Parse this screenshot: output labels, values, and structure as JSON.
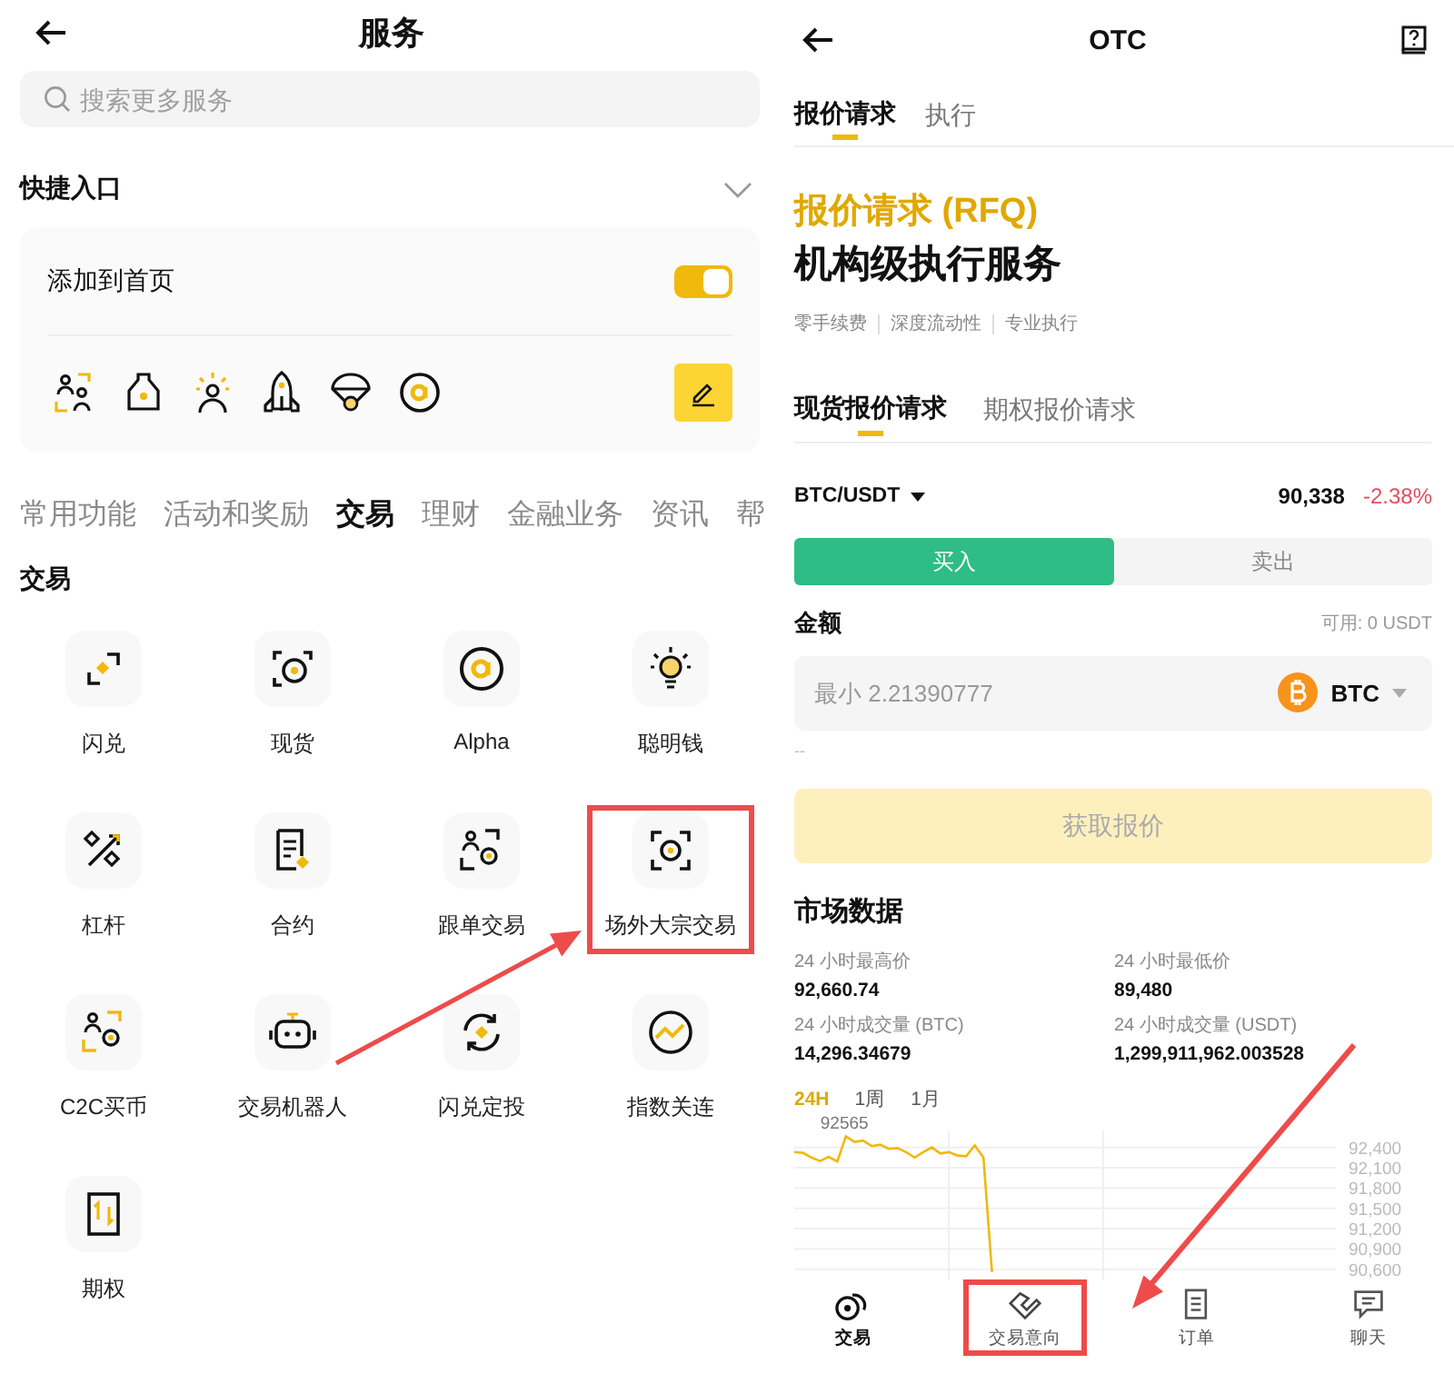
{
  "left": {
    "title": "服务",
    "search": {
      "placeholder": "搜索更多服务"
    },
    "quick_access": {
      "title": "快捷入口",
      "add_to_home": {
        "label": "添加到首页",
        "on": true
      }
    },
    "categories": [
      {
        "label": "常用功能",
        "selected": false
      },
      {
        "label": "活动和奖励",
        "selected": false
      },
      {
        "label": "交易",
        "selected": true
      },
      {
        "label": "理财",
        "selected": false
      },
      {
        "label": "金融业务",
        "selected": false
      },
      {
        "label": "资讯",
        "selected": false
      },
      {
        "label": "帮",
        "selected": false
      }
    ],
    "section_title": "交易",
    "services": [
      {
        "label": "闪兑",
        "highlighted": false
      },
      {
        "label": "现货",
        "highlighted": false
      },
      {
        "label": "Alpha",
        "highlighted": false
      },
      {
        "label": "聪明钱",
        "highlighted": false
      },
      {
        "label": "杠杆",
        "highlighted": false
      },
      {
        "label": "合约",
        "highlighted": false
      },
      {
        "label": "跟单交易",
        "highlighted": false
      },
      {
        "label": "场外大宗交易",
        "highlighted": true
      },
      {
        "label": "C2C买币",
        "highlighted": false
      },
      {
        "label": "交易机器人",
        "highlighted": false
      },
      {
        "label": "闪兑定投",
        "highlighted": false
      },
      {
        "label": "指数关连",
        "highlighted": false
      },
      {
        "label": "期权",
        "highlighted": false
      }
    ]
  },
  "right": {
    "title": "OTC",
    "tabs": [
      {
        "label": "报价请求",
        "selected": true
      },
      {
        "label": "执行",
        "selected": false
      }
    ],
    "headline": "报价请求 (RFQ)",
    "subheadline": "机构级执行服务",
    "features": [
      "零手续费",
      "深度流动性",
      "专业执行"
    ],
    "sub_tabs": [
      {
        "label": "现货报价请求",
        "selected": true
      },
      {
        "label": "期权报价请求",
        "selected": false
      }
    ],
    "pair": "BTC/USDT",
    "price": "90,338",
    "change": "-2.38%",
    "sides": [
      {
        "label": "买入",
        "selected": true
      },
      {
        "label": "卖出",
        "selected": false
      }
    ],
    "amount": {
      "label": "金额",
      "available": "可用: 0 USDT",
      "placeholder": "最小 2.21390777",
      "currency": "BTC",
      "estimate": "--"
    },
    "quote_button": {
      "label": "获取报价",
      "disabled": true
    },
    "market": {
      "title": "市场数据",
      "stats": [
        {
          "label": "24 小时最高价",
          "value": "92,660.74"
        },
        {
          "label": "24 小时最低价",
          "value": "89,480"
        },
        {
          "label": "24 小时成交量 (BTC)",
          "value": "14,296.34679"
        },
        {
          "label": "24 小时成交量 (USDT)",
          "value": "1,299,911,962.003528"
        }
      ],
      "periods": [
        {
          "label": "24H",
          "selected": true
        },
        {
          "label": "1周",
          "selected": false
        },
        {
          "label": "1月",
          "selected": false
        }
      ],
      "chart_data": {
        "type": "line",
        "grid": true,
        "ylim": [
          90450,
          92650
        ],
        "yticks": [
          {
            "value": 92400,
            "label": "92,400"
          },
          {
            "value": 92100,
            "label": "92,100"
          },
          {
            "value": 91800,
            "label": "91,800"
          },
          {
            "value": 91500,
            "label": "91,500"
          },
          {
            "value": 91200,
            "label": "91,200"
          },
          {
            "value": 90900,
            "label": "90,900"
          },
          {
            "value": 90600,
            "label": "90,600"
          }
        ],
        "series": [
          {
            "color": "#f0b90b",
            "values": [
              92330,
              92320,
              92250,
              92200,
              92260,
              92190,
              92565,
              92480,
              92500,
              92420,
              92440,
              92380,
              92390,
              92330,
              92250,
              92330,
              92400,
              92310,
              92330,
              92280,
              92270,
              92430,
              92250,
              90560,
              null,
              null,
              null,
              null,
              null,
              null,
              null,
              null,
              null,
              null,
              null,
              null,
              null,
              null,
              null,
              null,
              null,
              null,
              null,
              null,
              null,
              null,
              null,
              null,
              null,
              null,
              null,
              null,
              null,
              null,
              null,
              null,
              null,
              null,
              null,
              null,
              null,
              null,
              null,
              null
            ]
          }
        ],
        "annotations": [
          {
            "y": 92565,
            "text": "92565"
          }
        ]
      }
    },
    "nav": [
      {
        "label": "交易",
        "selected": true,
        "highlighted": false
      },
      {
        "label": "交易意向",
        "selected": false,
        "highlighted": true
      },
      {
        "label": "订单",
        "selected": false,
        "highlighted": false
      },
      {
        "label": "聊天",
        "selected": false,
        "highlighted": false
      }
    ]
  }
}
